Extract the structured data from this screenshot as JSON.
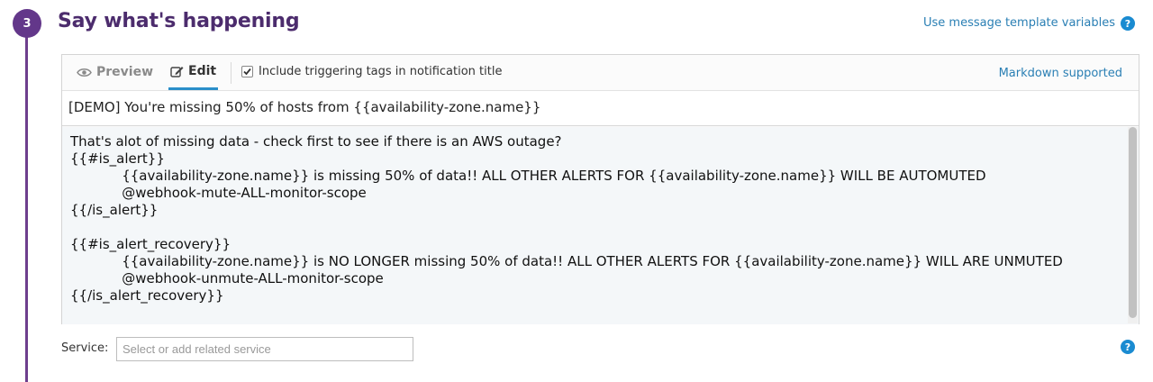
{
  "step": {
    "number": "3",
    "title": "Say what's happening"
  },
  "header": {
    "template_link": "Use message template variables",
    "help_icon": "?"
  },
  "editor": {
    "tabs": [
      {
        "label": "Preview",
        "icon": "eye-icon",
        "active": false
      },
      {
        "label": "Edit",
        "icon": "pencil-square-icon",
        "active": true
      }
    ],
    "include_tags": {
      "checked": true,
      "label": "Include triggering tags in notification title"
    },
    "markdown_link": "Markdown supported",
    "title_value": "[DEMO] You're missing 50% of hosts from {{availability-zone.name}}",
    "body_value": "That's alot of missing data - check first to see if there is an AWS outage?\n{{#is_alert}}\n\t{{availability-zone.name}} is missing 50% of data!! ALL OTHER ALERTS FOR {{availability-zone.name}} WILL BE AUTOMUTED\n\t@webhook-mute-ALL-monitor-scope\n{{/is_alert}}\n\n{{#is_alert_recovery}}\n\t{{availability-zone.name}} is NO LONGER missing 50% of data!! ALL OTHER ALERTS FOR {{availability-zone.name}} WILL ARE UNMUTED\n\t@webhook-unmute-ALL-monitor-scope\n{{/is_alert_recovery}}"
  },
  "service": {
    "label": "Service:",
    "placeholder": "Select or add related service",
    "value": ""
  },
  "colors": {
    "accent_purple": "#63378a",
    "link_blue": "#2a7fb4",
    "help_blue": "#1a8bd1"
  }
}
